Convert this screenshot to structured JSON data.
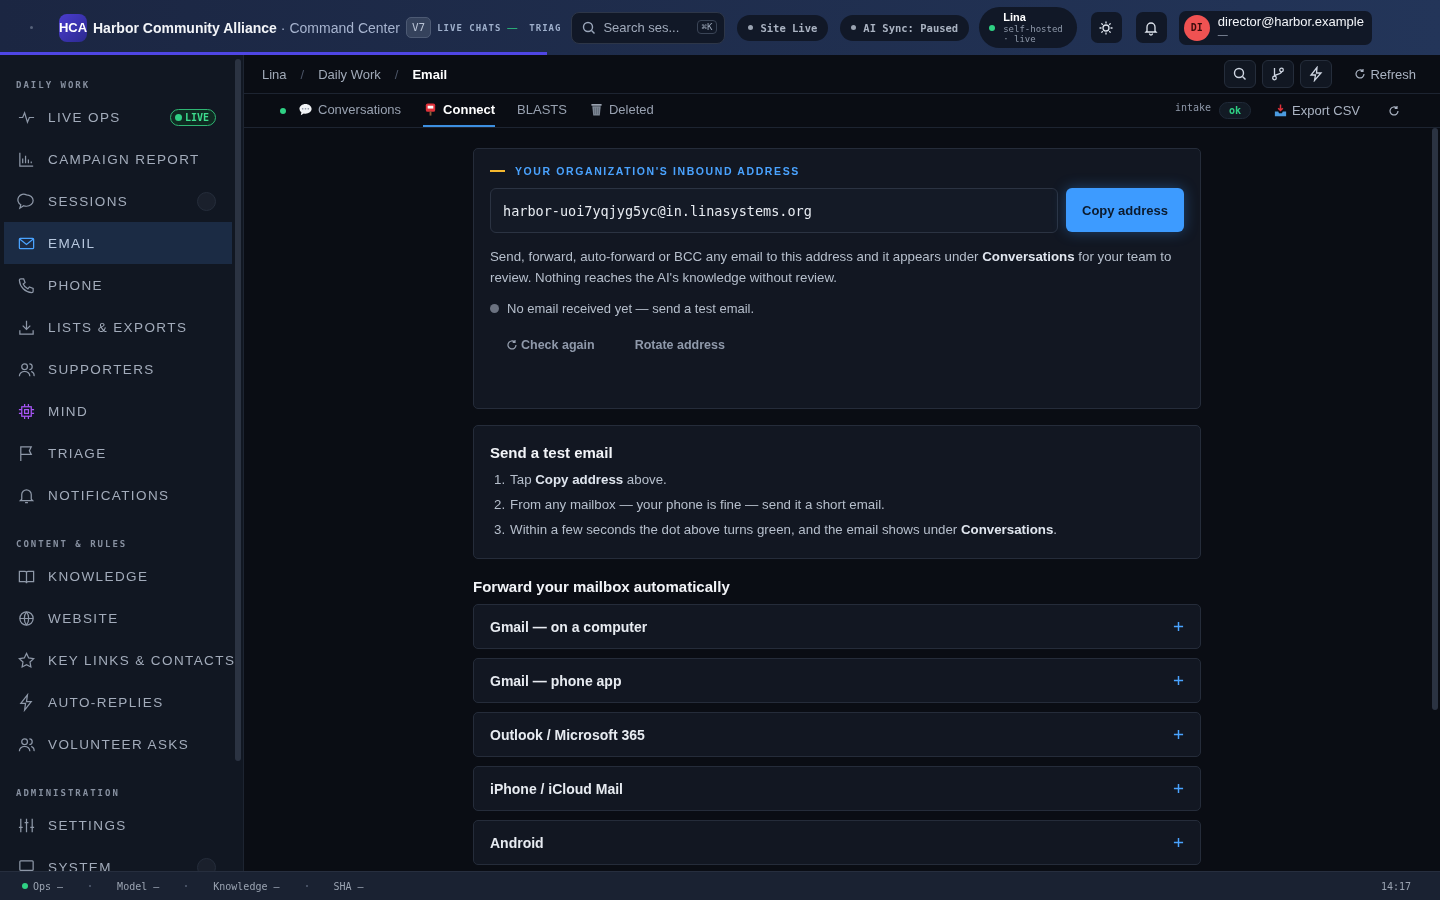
{
  "header": {
    "logo": "HCA",
    "org_name": "Harbor Community Alliance",
    "app_name": "· Command Center",
    "version": "V7",
    "live_chats": {
      "label": "LIVE CHATS",
      "value": "—"
    },
    "ticker_cut": "TRIAG",
    "search": {
      "placeholder": "Search ses...",
      "shortcut": "⌘K"
    },
    "pills": [
      {
        "label": "Site Live"
      },
      {
        "label": "AI Sync: Paused"
      }
    ],
    "instance": {
      "name": "Lina",
      "line_1": "self-hosted",
      "line_2": "· live",
      "online": true
    },
    "user": {
      "initials": "DI",
      "email": "director@harbor.example",
      "role": "—"
    },
    "progress": {
      "level": 0.38
    }
  },
  "sidebar": {
    "sections": [
      {
        "title": "DAILY WORK",
        "items": [
          {
            "label": "LIVE OPS",
            "selected": false,
            "kind": "badge",
            "badge": "LIVE"
          },
          {
            "label": "CAMPAIGN REPORT",
            "selected": false,
            "kind": "plain"
          },
          {
            "label": "SESSIONS",
            "selected": false,
            "kind": "counter"
          },
          {
            "label": "EMAIL",
            "selected": true,
            "kind": "plain"
          },
          {
            "label": "PHONE",
            "selected": false,
            "kind": "plain"
          },
          {
            "label": "LISTS & EXPORTS",
            "selected": false,
            "kind": "plain"
          },
          {
            "label": "SUPPORTERS",
            "selected": false,
            "kind": "plain"
          },
          {
            "label": "MIND",
            "selected": false,
            "kind": "plain"
          },
          {
            "label": "TRIAGE",
            "selected": false,
            "kind": "plain"
          },
          {
            "label": "NOTIFICATIONS",
            "selected": false,
            "kind": "plain"
          }
        ]
      },
      {
        "title": "CONTENT & RULES",
        "items": [
          {
            "label": "KNOWLEDGE",
            "selected": false,
            "kind": "plain"
          },
          {
            "label": "WEBSITE",
            "selected": false,
            "kind": "plain"
          },
          {
            "label": "KEY LINKS & CONTACTS",
            "selected": false,
            "kind": "plain"
          },
          {
            "label": "AUTO-REPLIES",
            "selected": false,
            "kind": "plain"
          },
          {
            "label": "VOLUNTEER ASKS",
            "selected": false,
            "kind": "plain"
          }
        ]
      },
      {
        "title": "ADMINISTRATION",
        "items": [
          {
            "label": "SETTINGS",
            "selected": false,
            "kind": "plain"
          },
          {
            "label": "SYSTEM",
            "selected": false,
            "kind": "counter"
          }
        ]
      }
    ]
  },
  "breadcrumb": [
    {
      "label": "Lina",
      "current": false
    },
    {
      "separator": "/",
      "label": "Daily Work",
      "current": false
    },
    {
      "separator": "/",
      "label": "Email",
      "current": true
    }
  ],
  "toolbar": {
    "refresh_label": "Refresh"
  },
  "tabs": {
    "live": true,
    "items": [
      {
        "label": "Conversations",
        "selected": false
      },
      {
        "label": "Connect",
        "selected": true
      },
      {
        "label": "BLASTS",
        "selected": false
      },
      {
        "label": "Deleted",
        "selected": false
      }
    ],
    "intake_label": "intake",
    "intake_status": "ok",
    "export_label": "Export CSV"
  },
  "inbound": {
    "heading": "YOUR ORGANIZATION'S INBOUND ADDRESS",
    "address": "harbor-uoi7yqjyg5yc@in.linasystems.org",
    "copy_label": "Copy address",
    "description": "Send, forward, auto-forward or BCC any email to this address and it appears under **Conversations** for your team to review. Nothing reaches the AI's knowledge without review.",
    "status": {
      "text": "No email received yet — send a test email.",
      "received": false
    },
    "check_label": "Check again",
    "rotate_label": "Rotate address"
  },
  "test": {
    "title": "Send a test email",
    "steps": [
      {
        "number": "1.",
        "text": "Tap **Copy address** above."
      },
      {
        "number": "2.",
        "text": "From any mailbox — your phone is fine — send it a short email."
      },
      {
        "number": "3.",
        "text": "Within a few seconds the dot above turns green, and the email shows under **Conversations**."
      }
    ]
  },
  "forward": {
    "title": "Forward your mailbox automatically",
    "providers": [
      {
        "label": "Gmail — on a computer",
        "expanded": false
      },
      {
        "label": "Gmail — phone app",
        "expanded": false
      },
      {
        "label": "Outlook / Microsoft 365",
        "expanded": false
      },
      {
        "label": "iPhone / iCloud Mail",
        "expanded": false
      },
      {
        "label": "Android",
        "expanded": false
      }
    ]
  },
  "status_bar": {
    "items": [
      {
        "label": "Ops —",
        "online": true
      },
      {
        "label": "Model —",
        "online": false
      },
      {
        "label": "Knowledge —",
        "online": false
      },
      {
        "label": "SHA —",
        "online": false
      }
    ],
    "time": "14:17"
  }
}
